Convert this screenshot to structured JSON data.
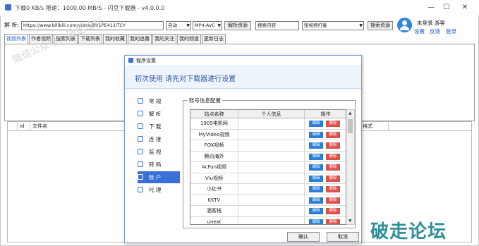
{
  "window": {
    "title": "下载0 KB/s  限速：1000.00 MB/S - 闪豆下载器 - v4.0.0.0",
    "controls": {
      "minimize": "—",
      "maximize": "☐",
      "close": "✕"
    }
  },
  "toolbar": {
    "url_label": "解  析:",
    "url_value": "https://www.bilibili.com/video/BV1PE411iTCY",
    "auto_select": "自动",
    "codec_select": "MP4-AVC",
    "parse_button": "解析资源",
    "search_input": "搜索内容",
    "search_type_select": "短视频打着",
    "search_button": "搜索资源"
  },
  "user": {
    "name": "未登录  游客",
    "links": [
      "设置",
      "反馈",
      "登录"
    ]
  },
  "tabs": [
    "视频列表",
    "作者视频",
    "搜索列表",
    "下载列表",
    "我的收藏",
    "我的追番",
    "我的关注",
    "我的频道",
    "更新日志"
  ],
  "watermark_text": "微信公众号：破走论坛",
  "list_columns": [
    "",
    "id",
    "文件名",
    "格式"
  ],
  "brand_watermark": "破走论坛",
  "dialog": {
    "title": "程序设置",
    "heading": "初次使用 请先对下载器进行设置",
    "nav": [
      "常 规",
      "解 析",
      "下 载",
      "连 接",
      "监 视",
      "转 码",
      "账 户",
      "代 理"
    ],
    "nav_icons": [
      "settings-icon",
      "parse-icon",
      "download-icon",
      "link-icon",
      "monitor-icon",
      "transcode-icon",
      "account-icon",
      "proxy-icon"
    ],
    "selected_nav": "账 户",
    "group_title": "账号信息配置",
    "grid_headers": [
      "站点名称",
      "个人信息",
      "操作"
    ],
    "sites": [
      "1905电影网",
      "MyVideo视频",
      "FOX视频",
      "腾讯海外",
      "AcFun视频",
      "Viu视频",
      "小红书",
      "KKTV",
      "酒客栈",
      "unext"
    ],
    "edit_label": "编辑",
    "delete_label": "删除",
    "ok_button": "确认",
    "cancel_button": "取消"
  }
}
